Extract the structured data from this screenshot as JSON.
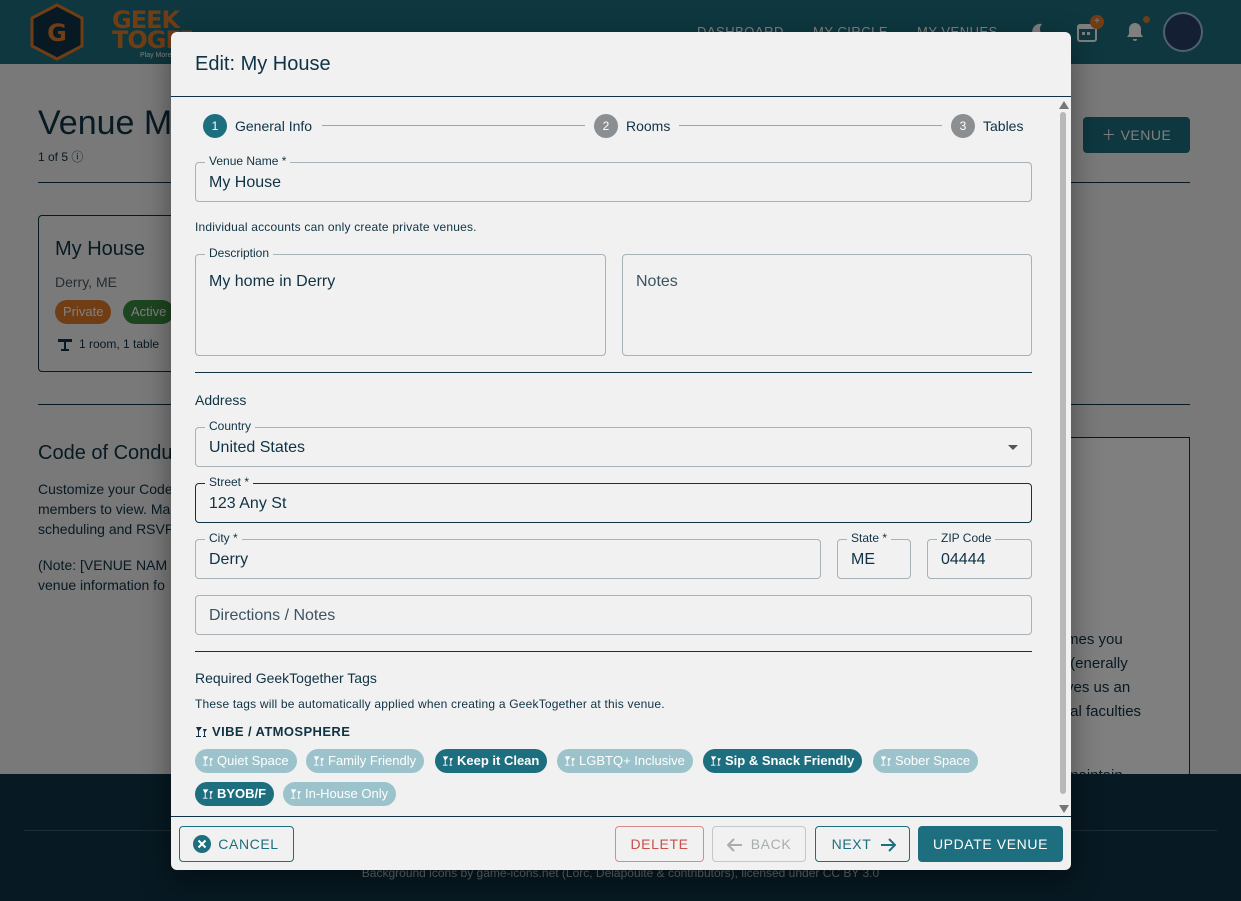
{
  "app": {
    "logo_text": "GEEK TOGETHER",
    "logo_tagline": "Play More",
    "nav": [
      "DASHBOARD",
      "MY CIRCLE",
      "MY VENUES"
    ],
    "calendar_badge": "+",
    "page_title": "Venue M",
    "page_subtitle": "1 of 5",
    "add_venue_label": "VENUE",
    "venue_card": {
      "name": "My House",
      "location": "Derry, ME",
      "chip_private": "Private",
      "chip_active": "Active",
      "rooms": "1 room, 1 table"
    },
    "coc": {
      "title": "Code of Condu",
      "text": "Customize your Code members to view. Ma scheduling and RSVP",
      "note": "(Note: [VENUE NAM venue information fo",
      "lines": [
        "mes you",
        "enerally).",
        "ves us an",
        "tal faculties",
        "maintain"
      ]
    },
    "footer_text": "Background icons by game-icons.net (Lorc, Delapouite & contributors), licensed under CC BY 3.0",
    "colors": {
      "primary": "#1d6e7e",
      "navy": "#0f3344",
      "accent": "#e07a2b",
      "danger": "#c9514a"
    }
  },
  "dialog": {
    "title": "Edit: My House",
    "steps": [
      {
        "num": "1",
        "label": "General Info",
        "active": true
      },
      {
        "num": "2",
        "label": "Rooms",
        "active": false
      },
      {
        "num": "3",
        "label": "Tables",
        "active": false
      }
    ],
    "venue_name": {
      "label": "Venue Name *",
      "value": "My House",
      "helper": "Individual accounts can only create private venues."
    },
    "description": {
      "label": "Description",
      "value": "My home in Derry"
    },
    "notes": {
      "placeholder": "Notes"
    },
    "address_heading": "Address",
    "country": {
      "label": "Country",
      "value": "United States"
    },
    "street": {
      "label": "Street *",
      "value": "123 Any St"
    },
    "city": {
      "label": "City *",
      "value": "Derry"
    },
    "state": {
      "label": "State *",
      "value": "ME"
    },
    "zip": {
      "label": "ZIP Code",
      "value": "04444"
    },
    "directions": {
      "placeholder": "Directions / Notes"
    },
    "tags_heading": "Required GeekTogether Tags",
    "tags_helper": "These tags will be automatically applied when creating a GeekTogether at this venue.",
    "vibe_heading": "VIBE / ATMOSPHERE",
    "tags": [
      {
        "label": "Quiet Space",
        "selected": false
      },
      {
        "label": "Family Friendly",
        "selected": false
      },
      {
        "label": "Keep it Clean",
        "selected": true
      },
      {
        "label": "LGBTQ+ Inclusive",
        "selected": false
      },
      {
        "label": "Sip & Snack Friendly",
        "selected": true
      },
      {
        "label": "Sober Space",
        "selected": false
      },
      {
        "label": "BYOB/F",
        "selected": true
      },
      {
        "label": "In-House Only",
        "selected": false
      }
    ],
    "buttons": {
      "cancel": "CANCEL",
      "delete": "DELETE",
      "back": "BACK",
      "next": "NEXT",
      "update": "UPDATE VENUE"
    }
  }
}
